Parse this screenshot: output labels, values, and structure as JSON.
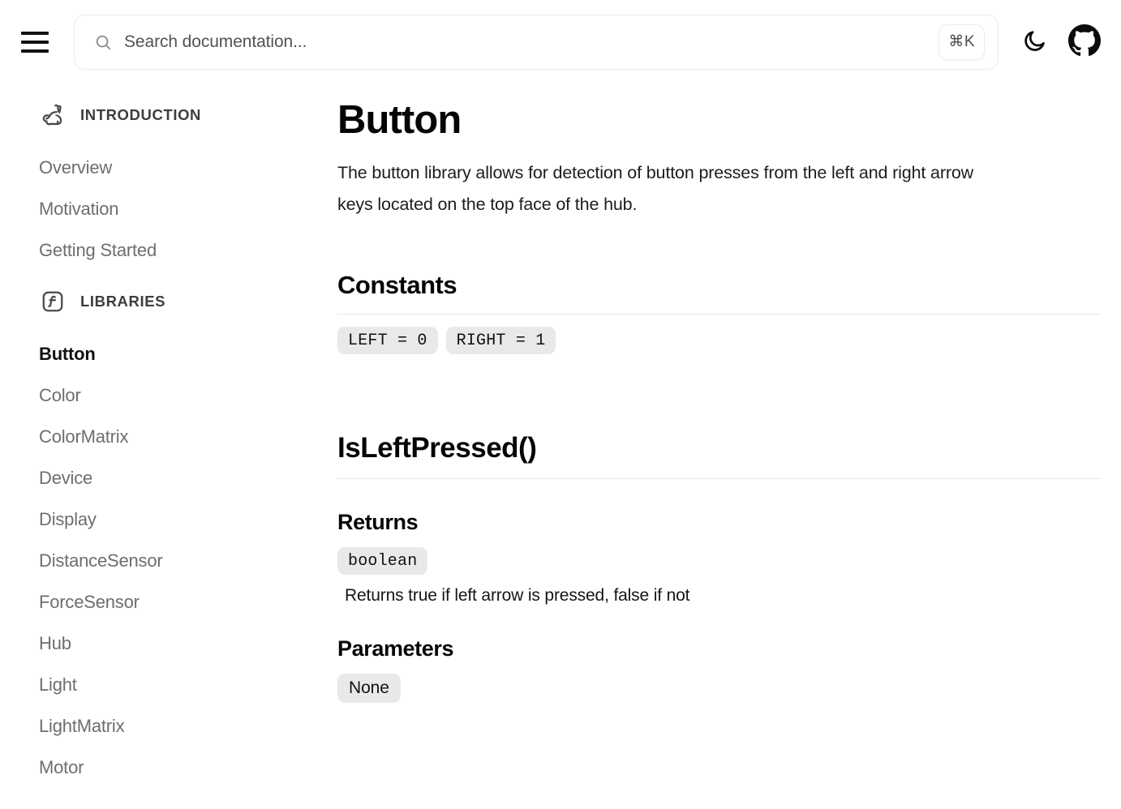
{
  "header": {
    "menu_label": "Menu",
    "search": {
      "placeholder": "Search documentation...",
      "value": "",
      "shortcut": "⌘K"
    },
    "theme_toggle_label": "Toggle dark mode",
    "github_label": "GitHub repository"
  },
  "sidebar": {
    "sections": [
      {
        "title": "INTRODUCTION",
        "icon": "rabbit-icon",
        "items": [
          {
            "label": "Overview",
            "active": false
          },
          {
            "label": "Motivation",
            "active": false
          },
          {
            "label": "Getting Started",
            "active": false
          }
        ]
      },
      {
        "title": "LIBRARIES",
        "icon": "function-icon",
        "items": [
          {
            "label": "Button",
            "active": true
          },
          {
            "label": "Color",
            "active": false
          },
          {
            "label": "ColorMatrix",
            "active": false
          },
          {
            "label": "Device",
            "active": false
          },
          {
            "label": "Display",
            "active": false
          },
          {
            "label": "DistanceSensor",
            "active": false
          },
          {
            "label": "ForceSensor",
            "active": false
          },
          {
            "label": "Hub",
            "active": false
          },
          {
            "label": "Light",
            "active": false
          },
          {
            "label": "LightMatrix",
            "active": false
          },
          {
            "label": "Motor",
            "active": false
          }
        ]
      }
    ]
  },
  "main": {
    "title": "Button",
    "description": "The button library allows for detection of button presses from the left and right arrow keys located on the top face of the hub.",
    "constants_section": {
      "heading": "Constants",
      "chips": [
        "LEFT = 0",
        "RIGHT = 1"
      ]
    },
    "method_section": {
      "name": "IsLeftPressed()",
      "returns": {
        "heading": "Returns",
        "type": "boolean",
        "description": "Returns true if left arrow is pressed, false if not"
      },
      "parameters": {
        "heading": "Parameters",
        "value": "None"
      }
    }
  },
  "colors": {
    "text_primary": "#050505",
    "text_muted": "#6e6e6e",
    "chip_bg": "#e9e9e9",
    "rule": "#e7e7e7",
    "border": "#ececec"
  }
}
